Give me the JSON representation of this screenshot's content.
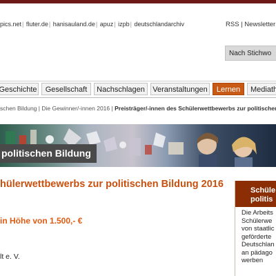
{
  "header": {
    "top_links": [
      {
        "label": "pics.net"
      },
      {
        "label": "fluter.de"
      },
      {
        "label": "hanisauland.de"
      },
      {
        "label": "apuz"
      },
      {
        "label": "izpb"
      },
      {
        "label": "deutschlandarchiv"
      }
    ],
    "separator": "|",
    "rss_label": "RSS",
    "newsletter_label": "Newsletter",
    "search_button_label": "Nach Stichwo"
  },
  "nav": {
    "items": [
      {
        "label": "Geschichte"
      },
      {
        "label": "Gesellschaft"
      },
      {
        "label": "Nachschlagen"
      },
      {
        "label": "Veranstaltungen"
      },
      {
        "label": "Lernen",
        "active": true
      },
      {
        "label": "Mediath"
      }
    ]
  },
  "breadcrumb": {
    "crumbs": [
      {
        "label": "schen Bildung"
      },
      {
        "label": "Die Gewinner/-innen 2016"
      }
    ],
    "current": "Preisträger/-innen des Schülerwettbewerbs zur politischen B"
  },
  "banner": {
    "label": "politischen Bildung"
  },
  "content": {
    "title": "hülerwettbewerbs zur politischen Bildung 2016",
    "prize": "in Höhe von 1.500,- €",
    "organization": "lt e. V."
  },
  "sidebar": {
    "heading_lines": [
      "Schüle",
      "politis"
    ],
    "body_lines": [
      "Die Arbeits",
      "Schülerwe",
      "von staatlic",
      "geförderte",
      "Deutschlan",
      "an pädago",
      "werben"
    ]
  },
  "colors": {
    "accent_orange": "#c85a16",
    "sidebar_header": "#8b2d05",
    "top_bar": "#6e1a1a"
  }
}
